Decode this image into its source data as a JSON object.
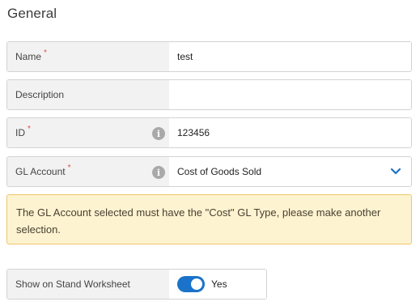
{
  "section": {
    "title": "General"
  },
  "fields": {
    "name": {
      "label": "Name",
      "required_mark": "*",
      "value": "test"
    },
    "description": {
      "label": "Description",
      "value": ""
    },
    "id": {
      "label": "ID",
      "required_mark": "*",
      "value": "123456",
      "info_glyph": "i"
    },
    "gl_account": {
      "label": "GL Account",
      "required_mark": "*",
      "value": "Cost of Goods Sold",
      "info_glyph": "i"
    }
  },
  "warning": {
    "text": "The GL Account selected must have the \"Cost\" GL Type, please make another selection."
  },
  "stand_worksheet": {
    "label": "Show on Stand Worksheet",
    "toggle_on": true,
    "toggle_text": "Yes"
  },
  "colors": {
    "accent": "#1a73c9",
    "required": "#e24b4b",
    "warning_bg": "#fdf3d1",
    "warning_border": "#f0c66a"
  },
  "icons": {
    "info": "info-icon",
    "dropdown": "chevron-down-icon"
  }
}
